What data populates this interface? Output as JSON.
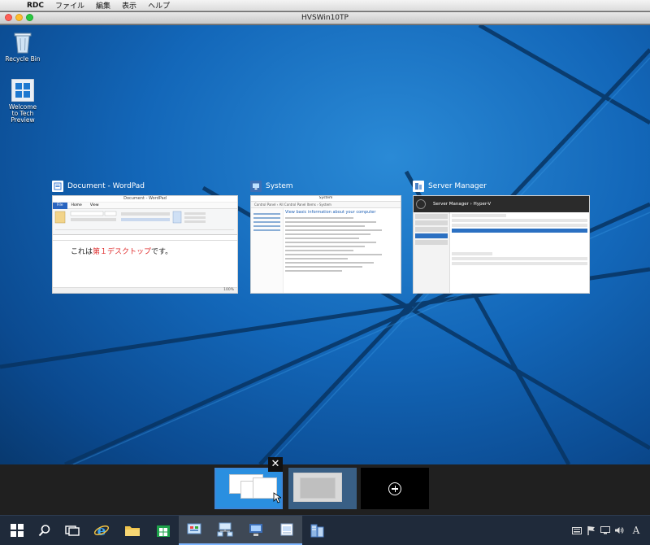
{
  "mac_menu": {
    "app": "RDC",
    "items": [
      "ファイル",
      "編集",
      "表示",
      "ヘルプ"
    ]
  },
  "window": {
    "title": "HVSWin10TP"
  },
  "desktop_icons": [
    {
      "label": "Recycle Bin",
      "icon": "recycle-bin-icon"
    },
    {
      "label": "Welcome to Tech Preview",
      "icon": "windows-logo-icon"
    }
  ],
  "task_view": {
    "windows": [
      {
        "title": "Document - WordPad",
        "icon": "wordpad-icon",
        "thumb_title": "Document - WordPad",
        "tabs": [
          "File",
          "Home",
          "View"
        ],
        "doc_text_prefix": "これは",
        "doc_text_highlight": "第１デスクトップ",
        "doc_text_suffix": "です。",
        "zoom": "100%"
      },
      {
        "title": "System",
        "icon": "system-icon",
        "thumb_title": "System",
        "address": "Control Panel › All Control Panel Items › System",
        "heading": "View basic information about your computer"
      },
      {
        "title": "Server Manager",
        "icon": "server-manager-icon",
        "thumb_title": "Server Manager",
        "breadcrumb": "Server Manager › Hyper-V"
      }
    ]
  },
  "virtual_desktops": {
    "close_glyph": "✕",
    "new_desktop_icon": "plus-circle-icon"
  },
  "taskbar": {
    "apps": [
      "start-icon",
      "search-icon",
      "task-view-icon",
      "ie-icon",
      "file-explorer-icon",
      "store-icon",
      "control-panel-icon",
      "network-icon",
      "system-icon",
      "wordpad-icon",
      "server-manager-icon"
    ],
    "tray": [
      "keyboard-icon",
      "flag-icon",
      "network-tray-icon",
      "volume-icon"
    ],
    "ime": "A"
  }
}
